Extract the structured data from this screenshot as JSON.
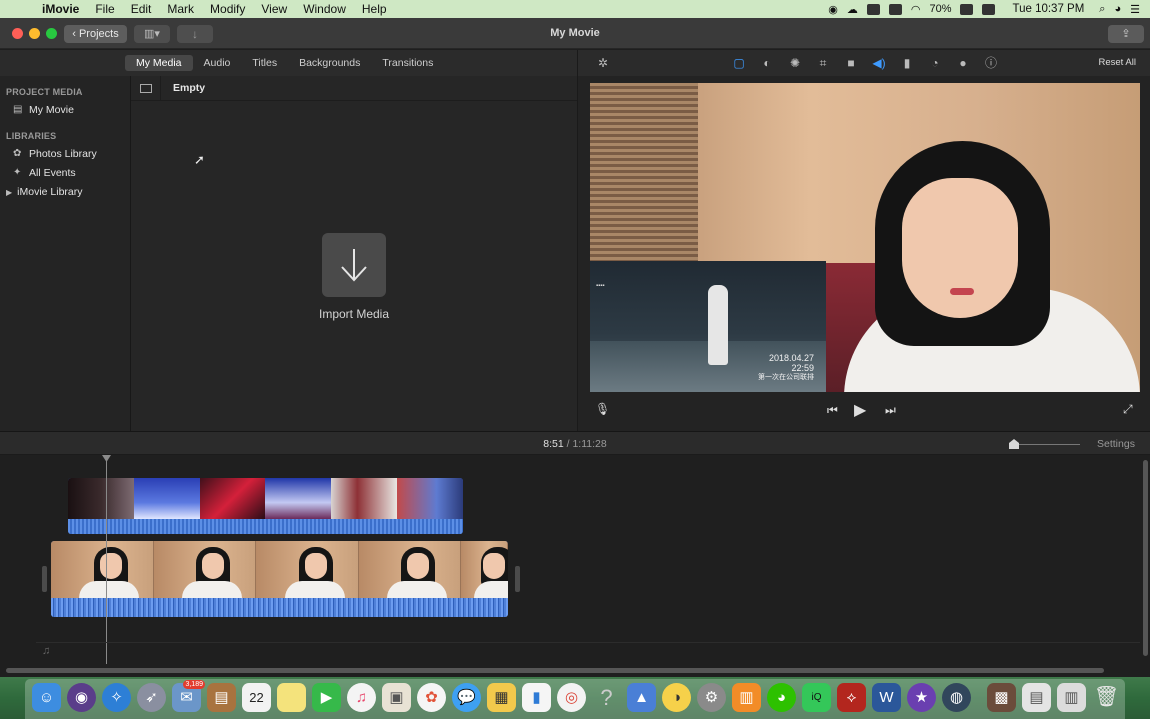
{
  "menubar": {
    "app_name": "iMovie",
    "items": [
      "File",
      "Edit",
      "Mark",
      "Modify",
      "View",
      "Window",
      "Help"
    ],
    "battery": "70%",
    "clock": "Tue 10:37 PM"
  },
  "window": {
    "title": "My Movie",
    "projects_label": "Projects"
  },
  "browser_tabs": [
    "My Media",
    "Audio",
    "Titles",
    "Backgrounds",
    "Transitions"
  ],
  "active_tab": "My Media",
  "sidebar": {
    "project_media_header": "PROJECT MEDIA",
    "project_item": "My Movie",
    "libraries_header": "LIBRARIES",
    "library_items": [
      "Photos Library",
      "All Events"
    ],
    "imovie_library": "iMovie Library"
  },
  "media_browser": {
    "filter_label": "Empty",
    "import_label": "Import Media"
  },
  "viewer": {
    "reset_all_label": "Reset All",
    "overlay_date": "2018.04.27",
    "overlay_time": "22:59",
    "overlay_caption": "第一次在公司联排"
  },
  "timeline": {
    "current_time": "8:51",
    "separator": "/",
    "total_time": "1:11:28",
    "settings_label": "Settings"
  },
  "dock": {
    "calendar_day": "22",
    "mail_badge": "3,189"
  },
  "colors": {
    "menubar_bg": "#cfe8c4",
    "accent_blue": "#3e9bff",
    "clip_blue": "#3769c7",
    "close": "#ff5f57",
    "minimize": "#febc2e",
    "zoom": "#28c840"
  }
}
